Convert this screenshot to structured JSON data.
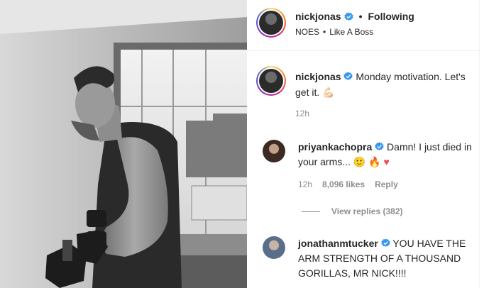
{
  "header": {
    "username": "nickjonas",
    "dot": "•",
    "follow_state": "Following",
    "audio": "NOES",
    "audio_sep": "•",
    "song": "Like A Boss"
  },
  "caption": {
    "username": "nickjonas",
    "text": "Monday motivation. Let's get it. 💪🏻",
    "time": "12h"
  },
  "comments": [
    {
      "username": "priyankachopra",
      "text_a": "Damn! I just died in your arms... 🙂 🔥",
      "heart": "♥",
      "time": "12h",
      "likes": "8,096 likes",
      "reply": "Reply",
      "view_replies": "View replies (382)"
    },
    {
      "username": "jonathanmtucker",
      "text": "YOU HAVE THE ARM STRENGTH OF A THOUSAND GORILLAS, MR NICK!!!!"
    }
  ],
  "colors": {
    "verified": "#3897f0",
    "muted": "#8e8e8e",
    "text": "#262626",
    "heart": "#ed4956"
  },
  "icons": {
    "verified": "verified-badge-icon"
  }
}
